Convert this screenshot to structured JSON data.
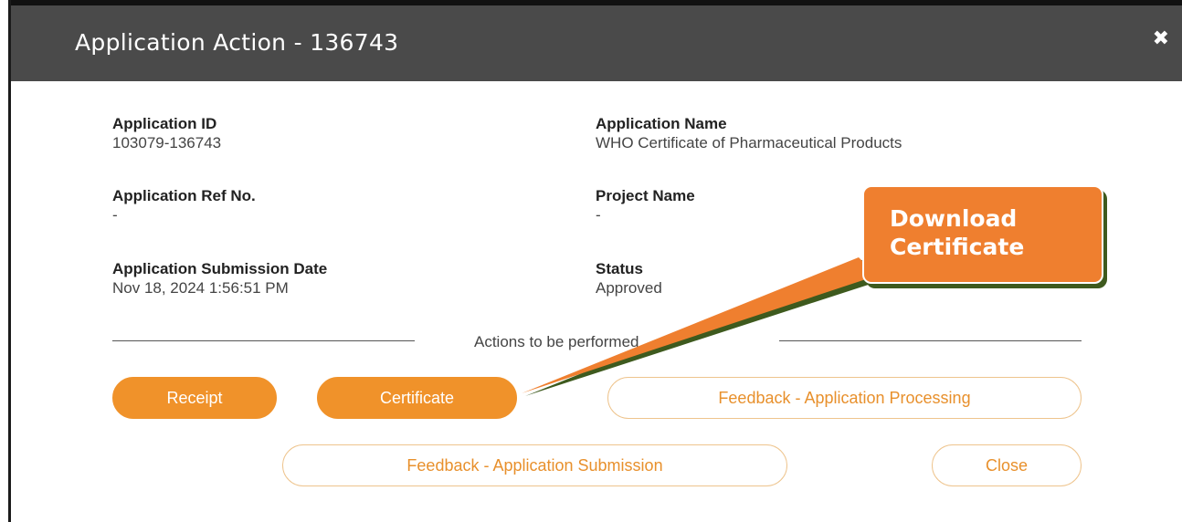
{
  "dialog": {
    "title": "Application Action - 136743",
    "close_icon": "close-x-icon"
  },
  "fields": {
    "application_id": {
      "label": "Application ID",
      "value": "103079-136743"
    },
    "application_name": {
      "label": "Application Name",
      "value": "WHO Certificate of Pharmaceutical Products"
    },
    "application_ref_no": {
      "label": "Application Ref No.",
      "value": "-"
    },
    "project_name": {
      "label": "Project Name",
      "value": "-"
    },
    "submission_date": {
      "label": "Application Submission Date",
      "value": "Nov 18, 2024 1:56:51 PM"
    },
    "status": {
      "label": "Status",
      "value": "Approved"
    }
  },
  "actions": {
    "caption": "Actions to be performed",
    "receipt": "Receipt",
    "certificate": "Certificate",
    "feedback_processing": "Feedback - Application Processing",
    "feedback_submission": "Feedback - Application Submission",
    "close": "Close"
  },
  "callout": {
    "line1": "Download",
    "line2": "Certificate"
  },
  "colors": {
    "header": "#4a4a4a",
    "accent": "#f0922a",
    "callout": "#ef7f2f",
    "callout_shadow": "#3e5a1e"
  }
}
